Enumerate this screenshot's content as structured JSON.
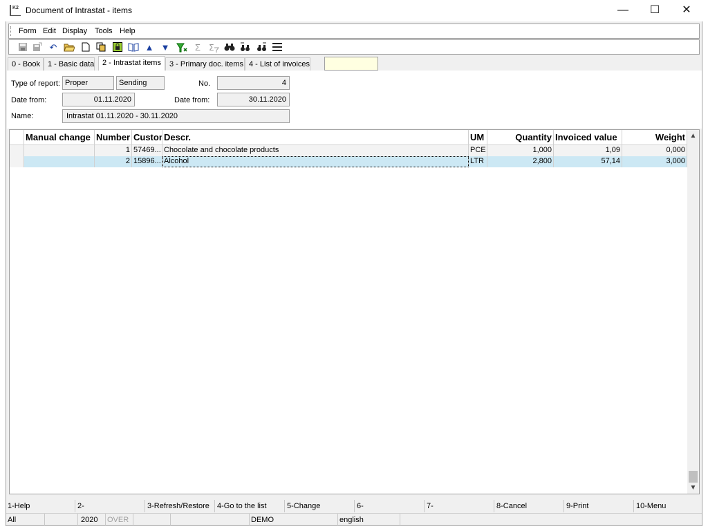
{
  "window": {
    "app_icon_text": "K2",
    "title": "Document of Intrastat - items",
    "minimize": "—",
    "maximize": "☐",
    "close": "✕"
  },
  "menu": [
    "Form",
    "Edit",
    "Display",
    "Tools",
    "Help"
  ],
  "toolbar": {
    "icons": [
      "save-icon",
      "save-as-icon",
      "undo-icon",
      "open-folder-icon",
      "new-document-icon",
      "copy-icon",
      "lock-icon",
      "book-icon",
      "arrow-up-icon",
      "arrow-down-icon",
      "filter-icon",
      "sum-icon",
      "sum-filter-icon",
      "binoculars-icon",
      "binoculars-next-icon",
      "binoculars-back-icon",
      "menu-lines-icon"
    ]
  },
  "tabs": [
    {
      "label": "0 - Book",
      "active": false
    },
    {
      "label": "1 - Basic data",
      "active": false
    },
    {
      "label": "2 - Intrastat items",
      "active": true
    },
    {
      "label": "3 - Primary doc. items",
      "active": false
    },
    {
      "label": "4 - List of invoices",
      "active": false
    }
  ],
  "form": {
    "type_label": "Type of report:",
    "type_value": "Proper",
    "direction_value": "Sending",
    "no_label": "No.",
    "no_value": "4",
    "date_from_label": "Date from:",
    "date_from_value": "01.11.2020",
    "date_to_label": "Date from:",
    "date_to_value": "30.11.2020",
    "name_label": "Name:",
    "name_value": "Intrastat 01.11.2020 - 30.11.2020"
  },
  "grid": {
    "columns": [
      "Manual change",
      "Number",
      "Custom",
      "Descr.",
      "UM",
      "Quantity",
      "Invoiced value",
      "Weight"
    ],
    "rows": [
      {
        "manual": "",
        "number": "1",
        "custom": "57469...",
        "descr": "Chocolate and chocolate products",
        "um": "PCE",
        "quantity": "1,000",
        "invoiced": "1,09",
        "weight": "0,000"
      },
      {
        "manual": "",
        "number": "2",
        "custom": "15896...",
        "descr": "Alcohol",
        "um": "LTR",
        "quantity": "2,800",
        "invoiced": "57,14",
        "weight": "3,000"
      }
    ]
  },
  "fkeys": [
    "1-Help",
    "2-",
    "3-Refresh/Restore",
    "4-Go to the list",
    "5-Change",
    "6-",
    "7-",
    "8-Cancel",
    "9-Print",
    "10-Menu"
  ],
  "status": {
    "scope": "All",
    "year": "2020",
    "mode": "OVER",
    "db": "DEMO",
    "language": "english"
  }
}
